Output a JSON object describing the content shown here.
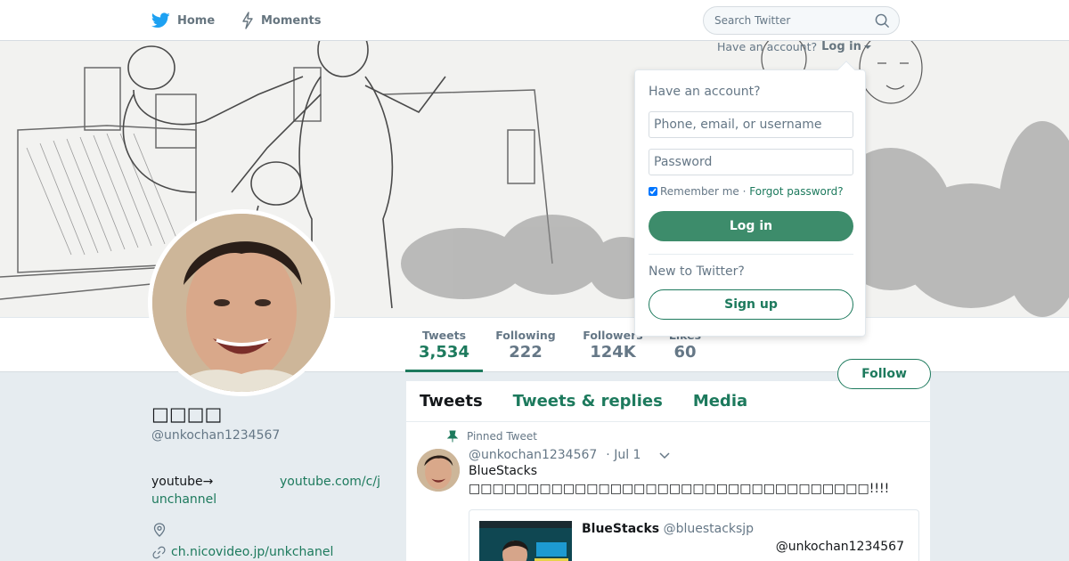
{
  "nav": {
    "home_label": "Home",
    "moments_label": "Moments",
    "search_placeholder": "Search Twitter"
  },
  "login_trigger": {
    "prompt": "Have an account?",
    "label": "Log in"
  },
  "login_dropdown": {
    "title": "Have an account?",
    "username_placeholder": "Phone, email, or username",
    "password_placeholder": "Password",
    "remember_label": "Remember me",
    "separator": "·",
    "forgot_label": "Forgot password?",
    "login_button": "Log in",
    "new_prompt": "New to Twitter?",
    "signup_button": "Sign up"
  },
  "profile_nav": {
    "stats": [
      {
        "label": "Tweets",
        "value": "3,534"
      },
      {
        "label": "Following",
        "value": "222"
      },
      {
        "label": "Followers",
        "value": "124K"
      },
      {
        "label": "Likes",
        "value": "60"
      }
    ],
    "follow_button": "Follow"
  },
  "profile": {
    "name": "□□□□",
    "handle": "@unkochan1234567",
    "bio_prefix": "youtube→",
    "bio_link_part1": "youtube.com/c/j",
    "bio_link_part2": "unchannel",
    "url": "ch.nicovideo.jp/unkchanel"
  },
  "timeline": {
    "tabs": [
      "Tweets",
      "Tweets & replies",
      "Media"
    ],
    "pinned_label": "Pinned Tweet",
    "tweet": {
      "handle": "@unkochan1234567",
      "date": "· Jul 1",
      "line1": "BlueStacks",
      "line2": "□□□□□□□□□□□□□□□□□□□□□□□□□□□□□□□□□□!!!!",
      "card": {
        "name": "BlueStacks",
        "handle": "@bluestacksjp",
        "mention": "@unkochan1234567"
      }
    }
  },
  "colors": {
    "accent": "#1d7a5d",
    "login_button": "#3d8c6b",
    "background": "#e6ecf0",
    "twitter_blue": "#1da1f2"
  }
}
